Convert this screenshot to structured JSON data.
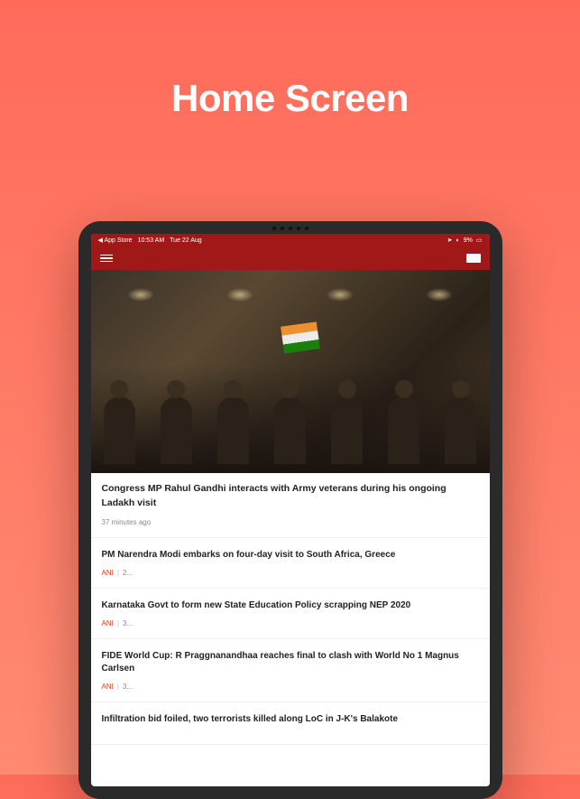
{
  "pageTitle": "Home Screen",
  "statusBar": {
    "appStore": "◀ App Store",
    "time": "10:53 AM",
    "date": "Tue 22 Aug",
    "battery": "9%"
  },
  "hero": {
    "headline": "Congress MP Rahul Gandhi interacts with Army veterans during his ongoing Ladakh visit",
    "timestamp": "37 minutes ago"
  },
  "articles": [
    {
      "headline": "PM Narendra Modi embarks on four-day visit to South Africa, Greece",
      "source": "ANI",
      "meta": "2..."
    },
    {
      "headline": "Karnataka Govt to form new State Education Policy scrapping NEP 2020",
      "source": "ANI",
      "meta": "3..."
    },
    {
      "headline": "FIDE World Cup: R Praggnanandhaa reaches final to clash with World No 1 Magnus Carlsen",
      "source": "ANI",
      "meta": "3..."
    },
    {
      "headline": "Infiltration bid foiled, two terrorists killed along LoC in J-K's Balakote",
      "source": "",
      "meta": ""
    }
  ]
}
